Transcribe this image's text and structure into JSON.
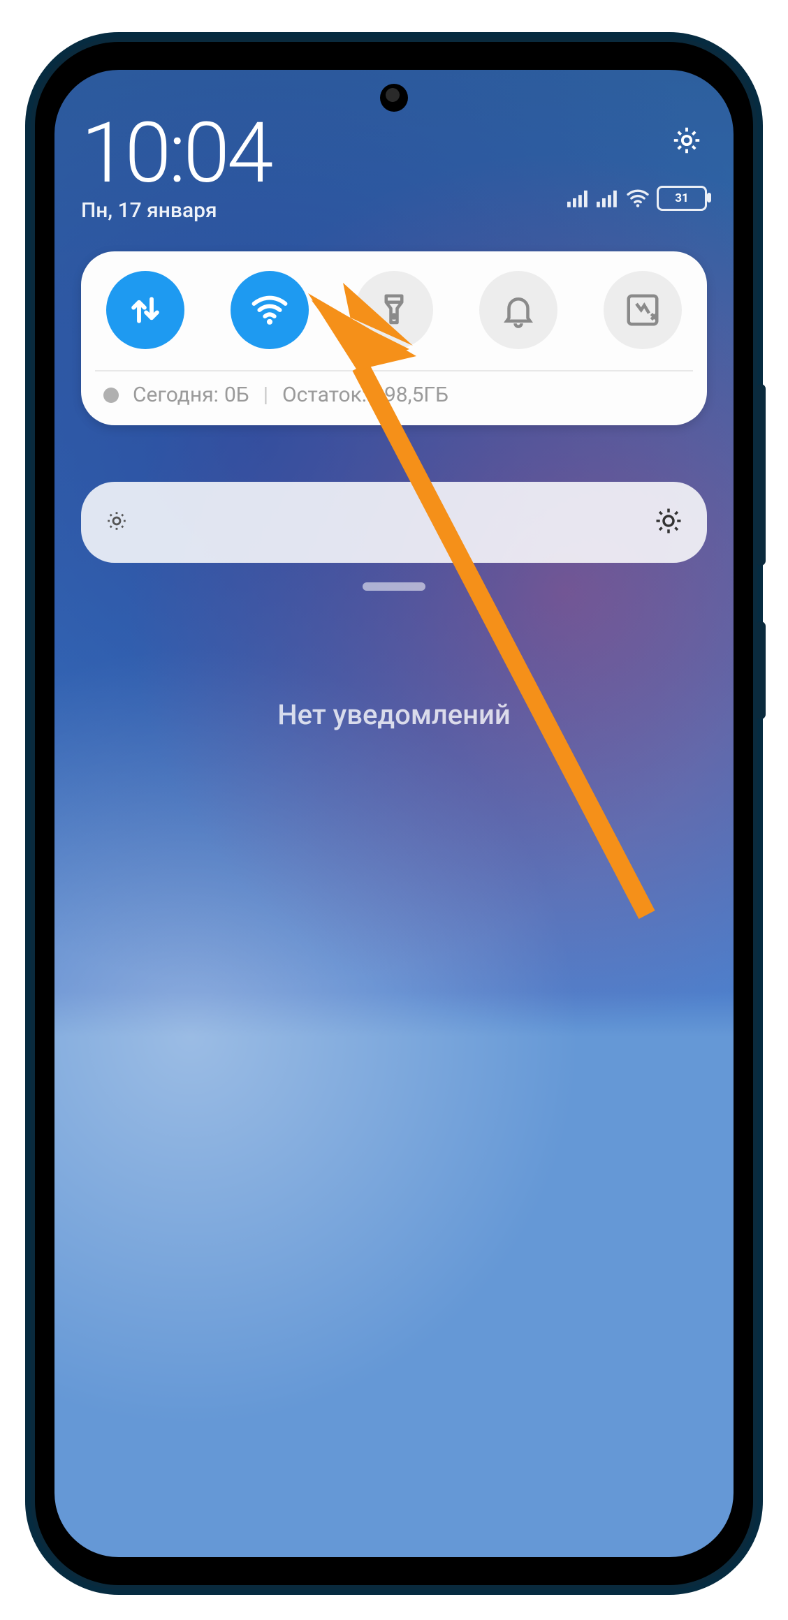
{
  "status": {
    "time": "10:04",
    "date": "Пн, 17 января",
    "battery_percent": "31"
  },
  "quick_settings": {
    "tiles": [
      {
        "name": "mobile-data",
        "active": true
      },
      {
        "name": "wifi",
        "active": true
      },
      {
        "name": "flashlight",
        "active": false
      },
      {
        "name": "dnd",
        "active": false
      },
      {
        "name": "screenshot",
        "active": false
      }
    ],
    "data_usage": {
      "today_label": "Сегодня:",
      "today_value": "0Б",
      "remaining_label": "Остаток:",
      "remaining_value": "498,5ГБ"
    }
  },
  "notifications": {
    "empty_text": "Нет уведомлений"
  },
  "annotation": {
    "arrow_color": "#f59019"
  }
}
